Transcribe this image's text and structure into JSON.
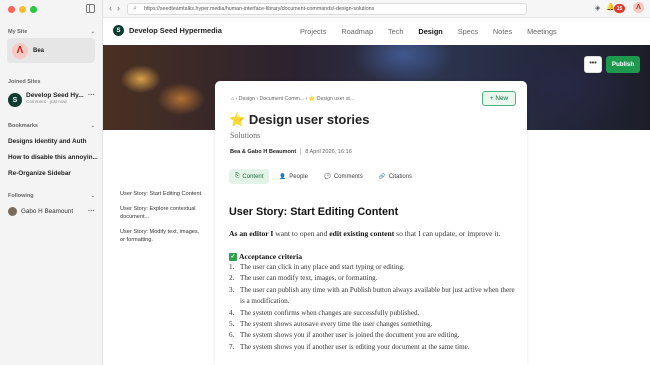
{
  "colors": {
    "accent": "#1d9a4e",
    "brand": "#0e3b2f",
    "notification": "#d93b30"
  },
  "sidebar": {
    "my_site_label": "My Site",
    "my_site_name": "Bea",
    "joined_label": "Joined Sites",
    "joined_site": {
      "title": "Develop Seed Hy...",
      "subtitle": "Comment · just now"
    },
    "bookmarks_label": "Bookmarks",
    "bookmarks": [
      "Designs Identity and Auth",
      "How to disable this annoyin...",
      "Re-Organize Sidebar"
    ],
    "following_label": "Following",
    "following": [
      "Gabo H Beamount"
    ]
  },
  "browser": {
    "url": "https://seedteamtalks.hyper.media/human-interface-library/document-commands/-design-solutions",
    "notification_count": "15"
  },
  "header": {
    "brand_name": "Develop Seed Hypermedia",
    "nav": [
      "Projects",
      "Roadmap",
      "Tech",
      "Design",
      "Specs",
      "Notes",
      "Meetings"
    ],
    "active_nav": "Design",
    "more_label": "•••",
    "publish_label": "Publish"
  },
  "document": {
    "breadcrumbs": "⌂ › Design › Document Comm... › ⭐ Design user st...",
    "new_label": "New",
    "title": "Design user stories",
    "subtitle": "Solutions",
    "authors": "Bea & Gabo H Beaumont",
    "date": "8 April 2026, 16:16",
    "tabs": [
      "Content",
      "People",
      "Comments",
      "Citations"
    ],
    "toc": [
      "User Story: Start Editing Content",
      "User Story: Explore contextual document...",
      "User Story: Modify text, images, or formatting."
    ],
    "section_heading": "User Story: Start Editing Content",
    "intro_bold1": "As an editor I",
    "intro_mid": " want to open and ",
    "intro_bold2": "edit existing content",
    "intro_end": " so that I can update, or improve it.",
    "criteria_title": "Acceptance criteria",
    "criteria": [
      "The user can click in any place and start typing or editing.",
      "The user can modify text, images, or formatting.",
      "The user can publish any time with an Publish button always available but just active when there is a modification.",
      "The system confirms when changes are successfully published.",
      "The system shows autosave every time the user changes something.",
      "The system shows you if another user is joined the document you are editing.",
      "The system shows you if another user is editing your document at the same time."
    ]
  }
}
